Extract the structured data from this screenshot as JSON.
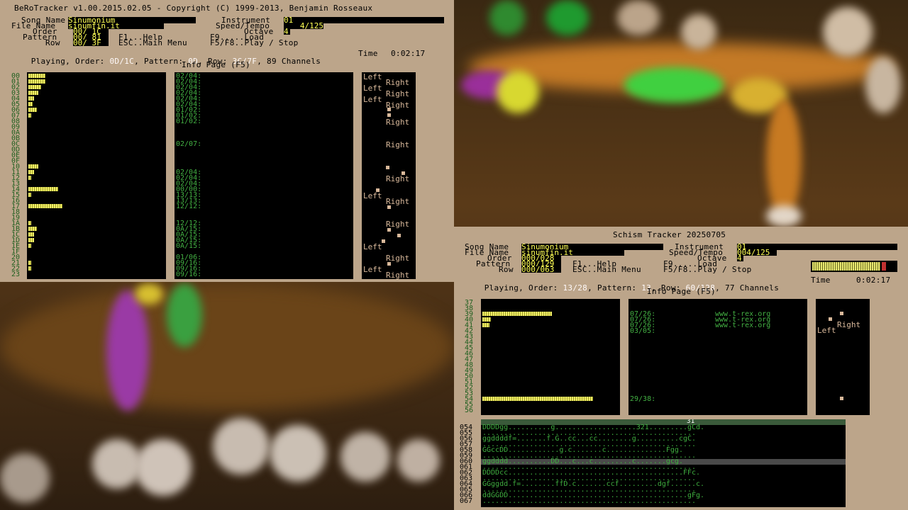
{
  "left": {
    "title": "BeRoTracker v1.00.2015.02.05 - Copyright (C) 1999-2013, Benjamin Rosseaux",
    "labels": {
      "song_name": "Song Name",
      "file_name": "File Name",
      "order": "Order",
      "pattern": "Pattern",
      "row": "Row",
      "instrument": "Instrument",
      "speed_tempo": "Speed/Tempo",
      "octave": "Octave",
      "f1": "F1...Help",
      "f9": "F9.....Load",
      "esc": "ESC..Main Menu",
      "f5": "F5/F8..Play / Stop"
    },
    "values": {
      "song_name": "Sinumonium",
      "file_name": "sinumfin.it",
      "order": "00/ 1C",
      "pattern": "00/ 81",
      "row": "00/ 3F",
      "instrument": "01",
      "speed_tempo": "4/125",
      "octave": "4"
    },
    "status": {
      "playing": "Playing, Order: ",
      "order": "0D/1C",
      "pattern_label": ", Pattern: ",
      "pattern": "0D",
      "row_label": ", Row: ",
      "row": "3C/7F",
      "channels": ", 89 Channels",
      "time_label": "Time",
      "time": "0:02:17"
    },
    "info_page": "Info Page (F5)",
    "channel_rows": "00\n01\n02\n03\n04\n05\n06\n07\n08\n09\n0A\n0B\n0C\n0D\n0E\n0F\n10\n11\n12\n13\n14\n15\n16\n17\n18\n19\n1A\n1B\n1C\n1D\n1E\n1F\n20\n21\n22\n23",
    "sample_text": "02/04:\n02/04:\n02/04:\n02/04:\n02/04:\n02/04:\n01/02:\n01/02:\n01/02:\n\n\n\n02/07:\n\n\n\n\n02/04:\n02/04:\n02/04:\n00/00:\n13/13:\n13/13:\n12/12:\n\n\n12/12:\n0A/15:\n0A/15:\n0A/15:\n0A/15:\n\n01/06:\n09/16:\n09/16:\n09/16:",
    "left_word": "Left",
    "right_word": "Right"
  },
  "right": {
    "title": "Schism Tracker 20250705",
    "labels": {
      "song_name": "Song Name",
      "file_name": "File Name",
      "order": "Order",
      "pattern": "Pattern",
      "row": "Row",
      "instrument": "Instrument",
      "speed_tempo": "Speed/Tempo",
      "octave": "Octave",
      "f1": "F1...Help",
      "f9": "F9.....Load",
      "esc": "ESC..Main Menu",
      "f5": "F5/F8..Play / Stop"
    },
    "values": {
      "song_name": "Sinumonium",
      "file_name": "sinumfin.it",
      "order": "000/028",
      "pattern": "000/129",
      "row": "000/063",
      "instrument": "01",
      "speed_tempo": "004/125",
      "octave": "4"
    },
    "status": {
      "playing": "Playing, Order: ",
      "order": "13/28",
      "pattern_label": ", Pattern: ",
      "pattern": "13",
      "row_label": ", Row: ",
      "row": "60/128",
      "channels": ", 77 Channels",
      "time_label": "Time",
      "time": "0:02:17"
    },
    "info_page": "Info Page (F5)",
    "channel_rows": "37\n38\n39\n40\n41\n42\n43\n44\n45\n46\n47\n48\n49\n50\n51\n52\n53\n54\n55\n56",
    "sample_text": "07/26:\n07/26:\n07/26:\n03/05:",
    "url_text": "www.t-rex.org\nwww.t-rex.org\nwww.t-rex.org",
    "sample_bottom": "29/38:",
    "left_word": "Left",
    "right_word": "Right",
    "pattern_rows": "054\n055\n056\n057\n058\n059\n060\n061\n062\n063\n064\n065\n066\n067",
    "pattern_data": "DDDDgg..........g...................321.........gCd.\n..................................................\nggddddf=.......f.G..cc...cc........g..........cgC.\n..................................................\nGGccDD............g.c.......c..............Fgg.\n..................................................\nggdddd..........DD...c...c.........c.......gcg.\n..................................................\nDDDDcc.........................................FFc.\n..................................................\nGGggdd.f=........ffD.c.......ccf.........dgf......c.\n..................................................\nddGGDD..........................................gFg.\n..................................................",
    "ruler_marker": "31"
  }
}
